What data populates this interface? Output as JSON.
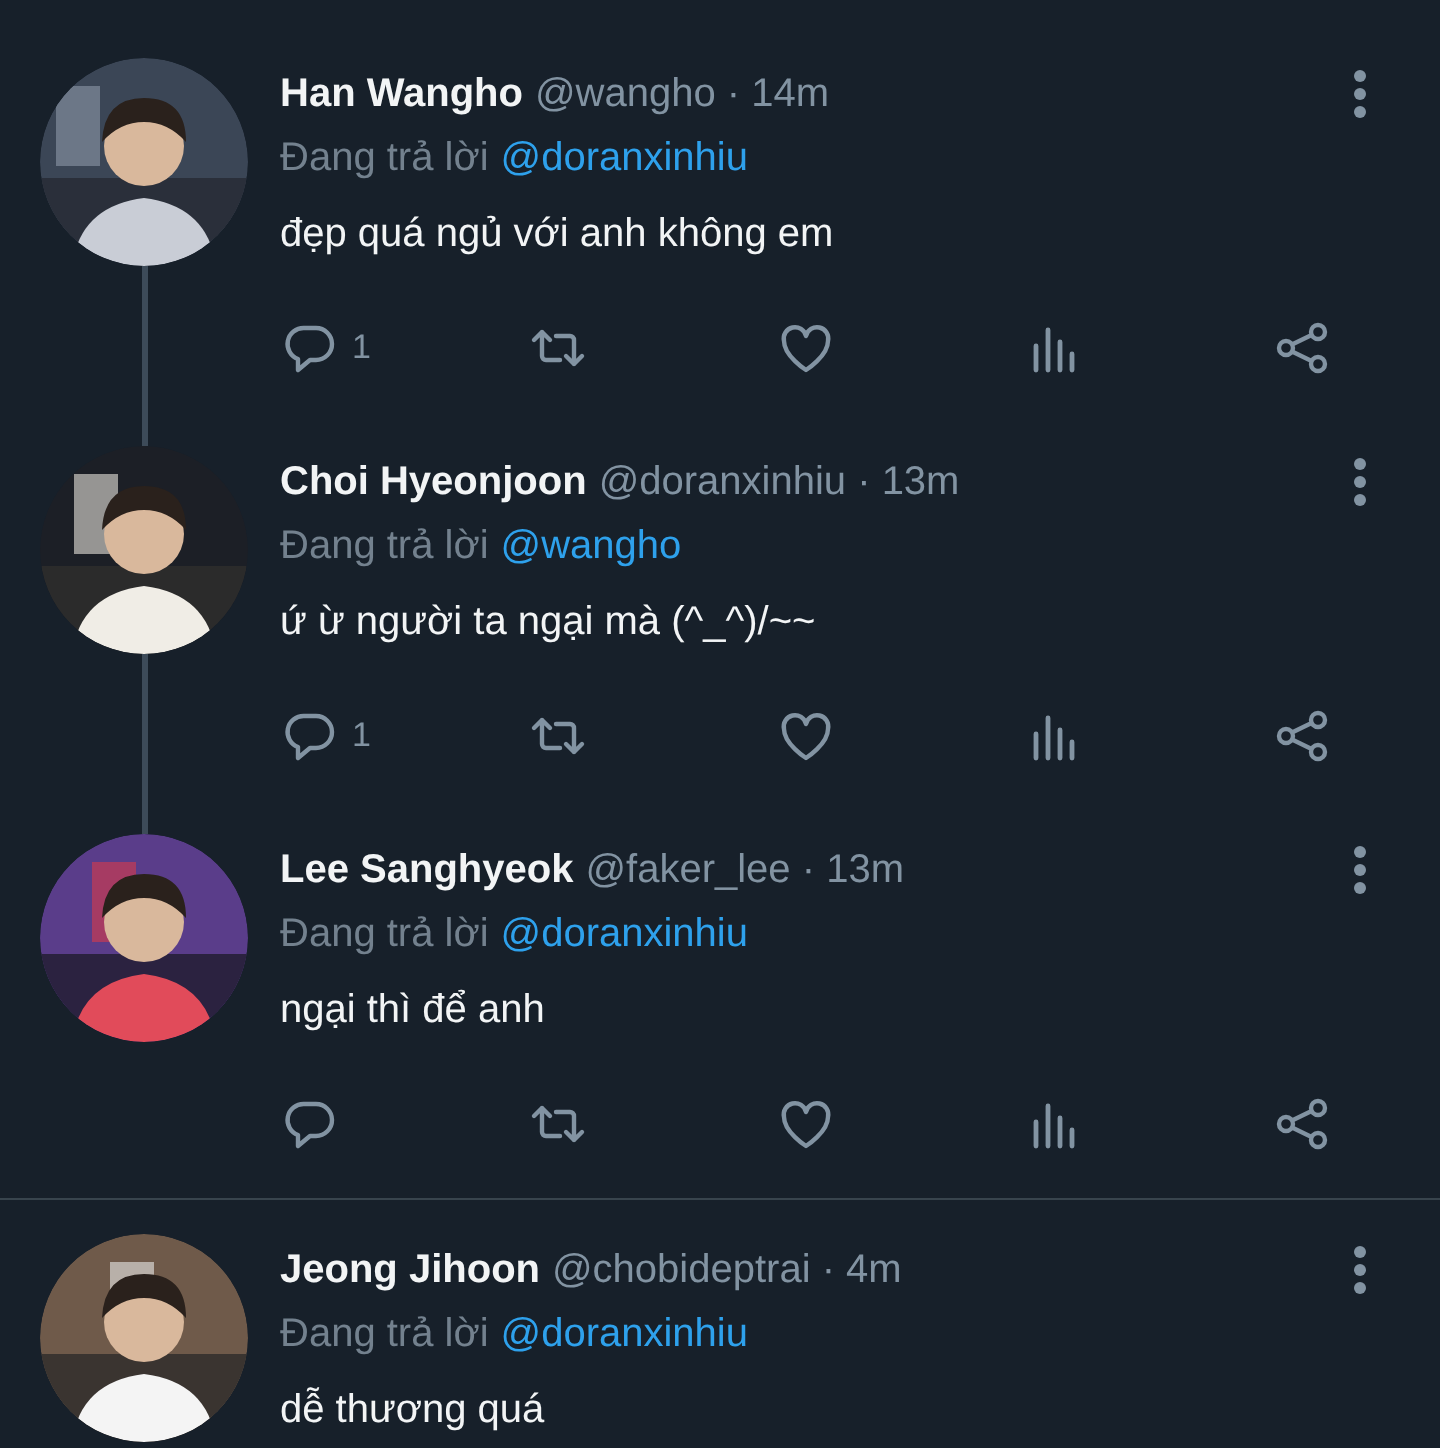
{
  "tweets": [
    {
      "name": "Han Wangho",
      "meta": "@wangho · 14m",
      "reply_label": "Đang trả lời",
      "reply_to": "@doranxinhiu",
      "text": "đẹp quá ngủ với anh không em",
      "thread_line": true,
      "actions": {
        "shown": true,
        "reply_count": "1"
      }
    },
    {
      "name": "Choi Hyeonjoon",
      "meta": "@doranxinhiu · 13m",
      "reply_label": "Đang trả lời",
      "reply_to": "@wangho",
      "text": "ứ ừ người ta ngại mà (^_^)/~~",
      "thread_line": true,
      "actions": {
        "shown": true,
        "reply_count": "1"
      }
    },
    {
      "name": "Lee Sanghyeok",
      "meta": "@faker_lee · 13m",
      "reply_label": "Đang trả lời",
      "reply_to": "@doranxinhiu",
      "text": "ngại thì để anh",
      "thread_line": false,
      "actions": {
        "shown": true
      }
    },
    {
      "name": "Jeong Jihoon",
      "meta": "@chobideptrai · 4m",
      "reply_label": "Đang trả lời",
      "reply_to": "@doranxinhiu",
      "text": "dễ thương quá"
    }
  ]
}
